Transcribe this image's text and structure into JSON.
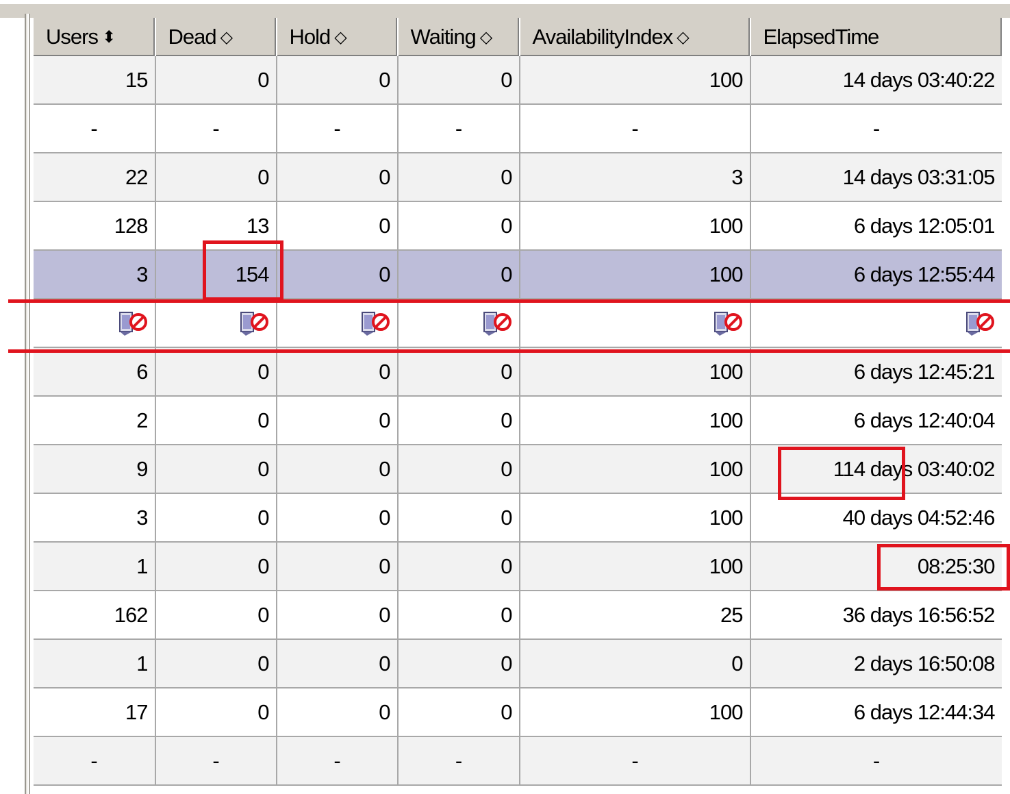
{
  "columns": [
    {
      "label": "Users",
      "sort": "desc"
    },
    {
      "label": "Dead",
      "sort": "none"
    },
    {
      "label": "Hold",
      "sort": "none"
    },
    {
      "label": "Waiting",
      "sort": "none"
    },
    {
      "label": "AvailabilityIndex",
      "sort": "none"
    },
    {
      "label": "ElapsedTime",
      "sort": ""
    }
  ],
  "sort_glyphs": {
    "desc": "⬍",
    "none": "◇"
  },
  "rows": [
    {
      "type": "data",
      "cells": [
        "15",
        "0",
        "0",
        "0",
        "100",
        "14 days 03:40:22"
      ]
    },
    {
      "type": "dash",
      "cells": [
        "-",
        "-",
        "-",
        "-",
        "-",
        "-"
      ]
    },
    {
      "type": "data",
      "cells": [
        "22",
        "0",
        "0",
        "0",
        "3",
        "14 days 03:31:05"
      ]
    },
    {
      "type": "data",
      "cells": [
        "128",
        "13",
        "0",
        "0",
        "100",
        "6 days 12:05:01"
      ]
    },
    {
      "type": "selected",
      "cells": [
        "3",
        "154",
        "0",
        "0",
        "100",
        "6 days 12:55:44"
      ]
    },
    {
      "type": "icons",
      "icon": "document-stop-icon"
    },
    {
      "type": "data",
      "cells": [
        "6",
        "0",
        "0",
        "0",
        "100",
        "6 days 12:45:21"
      ]
    },
    {
      "type": "data",
      "cells": [
        "2",
        "0",
        "0",
        "0",
        "100",
        "6 days 12:40:04"
      ]
    },
    {
      "type": "data",
      "cells": [
        "9",
        "0",
        "0",
        "0",
        "100",
        "114 days 03:40:02"
      ]
    },
    {
      "type": "data",
      "cells": [
        "3",
        "0",
        "0",
        "0",
        "100",
        "40 days 04:52:46"
      ]
    },
    {
      "type": "data",
      "cells": [
        "1",
        "0",
        "0",
        "0",
        "100",
        "08:25:30"
      ]
    },
    {
      "type": "data",
      "cells": [
        "162",
        "0",
        "0",
        "0",
        "25",
        "36 days 16:56:52"
      ]
    },
    {
      "type": "data",
      "cells": [
        "1",
        "0",
        "0",
        "0",
        "0",
        "2 days 16:50:08"
      ]
    },
    {
      "type": "data",
      "cells": [
        "17",
        "0",
        "0",
        "0",
        "100",
        "6 days 12:44:34"
      ]
    },
    {
      "type": "dash",
      "cells": [
        "-",
        "-",
        "-",
        "-",
        "-",
        "-"
      ]
    }
  ],
  "colors": {
    "header_bg": "#d4d0c8",
    "selected_row": "#bdbdd9",
    "alt_row": "#f2f2f2",
    "annotation_red": "#e0141e",
    "stop_icon_red": "#e0141e"
  }
}
